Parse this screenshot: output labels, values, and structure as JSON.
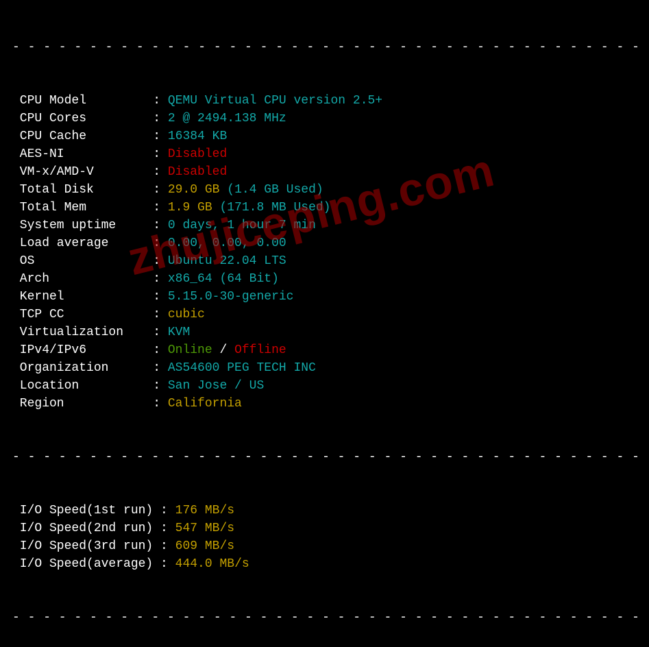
{
  "divider": "- - - - - - - - - - - - - - - - - - - - - - - - - - - - - - - - - - - - - - - - - - -",
  "rows": [
    {
      "label": "CPU Model         ",
      "segments": [
        {
          "class": "cyan",
          "text": "QEMU Virtual CPU version 2.5+"
        }
      ]
    },
    {
      "label": "CPU Cores         ",
      "segments": [
        {
          "class": "cyan",
          "text": "2 @ 2494.138 MHz"
        }
      ]
    },
    {
      "label": "CPU Cache         ",
      "segments": [
        {
          "class": "cyan",
          "text": "16384 KB"
        }
      ]
    },
    {
      "label": "AES-NI            ",
      "segments": [
        {
          "class": "red",
          "text": "Disabled"
        }
      ]
    },
    {
      "label": "VM-x/AMD-V        ",
      "segments": [
        {
          "class": "red",
          "text": "Disabled"
        }
      ]
    },
    {
      "label": "Total Disk        ",
      "segments": [
        {
          "class": "yellow",
          "text": "29.0 GB"
        },
        {
          "class": "cyan",
          "text": " (1.4 GB Used)"
        }
      ]
    },
    {
      "label": "Total Mem         ",
      "segments": [
        {
          "class": "yellow",
          "text": "1.9 GB"
        },
        {
          "class": "cyan",
          "text": " (171.8 MB Used)"
        }
      ]
    },
    {
      "label": "System uptime     ",
      "segments": [
        {
          "class": "cyan",
          "text": "0 days, 1 hour 7 min"
        }
      ]
    },
    {
      "label": "Load average      ",
      "segments": [
        {
          "class": "cyan",
          "text": "0.00, 0.00, 0.00"
        }
      ]
    },
    {
      "label": "OS                ",
      "segments": [
        {
          "class": "cyan",
          "text": "Ubuntu 22.04 LTS"
        }
      ]
    },
    {
      "label": "Arch              ",
      "segments": [
        {
          "class": "cyan",
          "text": "x86_64 (64 Bit)"
        }
      ]
    },
    {
      "label": "Kernel            ",
      "segments": [
        {
          "class": "cyan",
          "text": "5.15.0-30-generic"
        }
      ]
    },
    {
      "label": "TCP CC            ",
      "segments": [
        {
          "class": "yellow",
          "text": "cubic"
        }
      ]
    },
    {
      "label": "Virtualization    ",
      "segments": [
        {
          "class": "cyan",
          "text": "KVM"
        }
      ]
    },
    {
      "label": "IPv4/IPv6         ",
      "segments": [
        {
          "class": "green",
          "text": "Online"
        },
        {
          "class": "white",
          "text": " / "
        },
        {
          "class": "red",
          "text": "Offline"
        }
      ]
    },
    {
      "label": "Organization      ",
      "segments": [
        {
          "class": "cyan",
          "text": "AS54600 PEG TECH INC"
        }
      ]
    },
    {
      "label": "Location          ",
      "segments": [
        {
          "class": "cyan",
          "text": "San Jose / US"
        }
      ]
    },
    {
      "label": "Region            ",
      "segments": [
        {
          "class": "yellow",
          "text": "California"
        }
      ]
    }
  ],
  "io_rows": [
    {
      "label": "I/O Speed(1st run) ",
      "value": "176 MB/s"
    },
    {
      "label": "I/O Speed(2nd run) ",
      "value": "547 MB/s"
    },
    {
      "label": "I/O Speed(3rd run) ",
      "value": "609 MB/s"
    },
    {
      "label": "I/O Speed(average) ",
      "value": "444.0 MB/s"
    }
  ],
  "watermark": "zhujiceping.com"
}
